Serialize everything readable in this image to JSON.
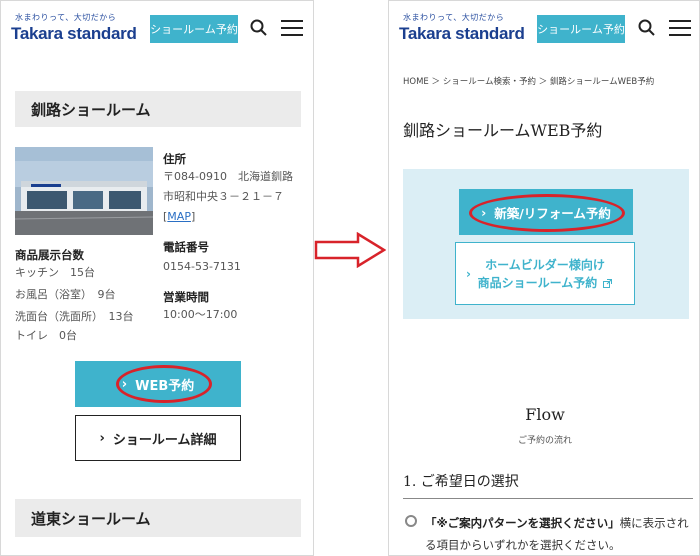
{
  "brand": {
    "tagline": "水まわりって、大切だから",
    "name": "Takara standard"
  },
  "header": {
    "reserve_label": "ショールーム予約"
  },
  "left": {
    "showroom_title": "釧路ショールーム",
    "address_label": "住所",
    "address_lines": [
      "〒084-0910　北海道釧路",
      "市昭和中央３－２１－７"
    ],
    "map_link": "MAP",
    "phone_label": "電話番号",
    "phone": "0154-53-7131",
    "hours_label": "営業時間",
    "hours": "10:00〜17:00",
    "display_label": "商品展示台数",
    "display_items": [
      "キッチン　15台",
      "お風呂（浴室）　9台",
      "洗面台（洗面所）　13台",
      "トイレ　0台"
    ],
    "web_button": "WEB予約",
    "detail_button": "ショールーム詳細",
    "next_showroom": "道東ショールーム"
  },
  "right": {
    "breadcrumb": [
      "HOME",
      "ショールーム検索・予約",
      "釧路ショールームWEB予約"
    ],
    "page_title": "釧路ショールームWEB予約",
    "new_button": "新築/リフォーム予約",
    "builder_button_lines": [
      "ホームビルダー様向け",
      "商品ショールーム予約"
    ],
    "flow_title": "Flow",
    "flow_subtitle": "ご予約の流れ",
    "step_title": "1.  ご希望日の選択",
    "step_text_quote": "「※ご案内パターンを選択ください」",
    "step_text_rest": "横に表示される項目からいずれかを選択ください。"
  },
  "colors": {
    "accent": "#3fb3cc",
    "highlight": "#d8232a",
    "box_bg": "#dbeef5",
    "brand_blue": "#1b3f8f"
  },
  "icons": [
    "search-icon",
    "menu-icon",
    "chevron-right-icon",
    "external-link-icon",
    "arrow-right-icon"
  ]
}
